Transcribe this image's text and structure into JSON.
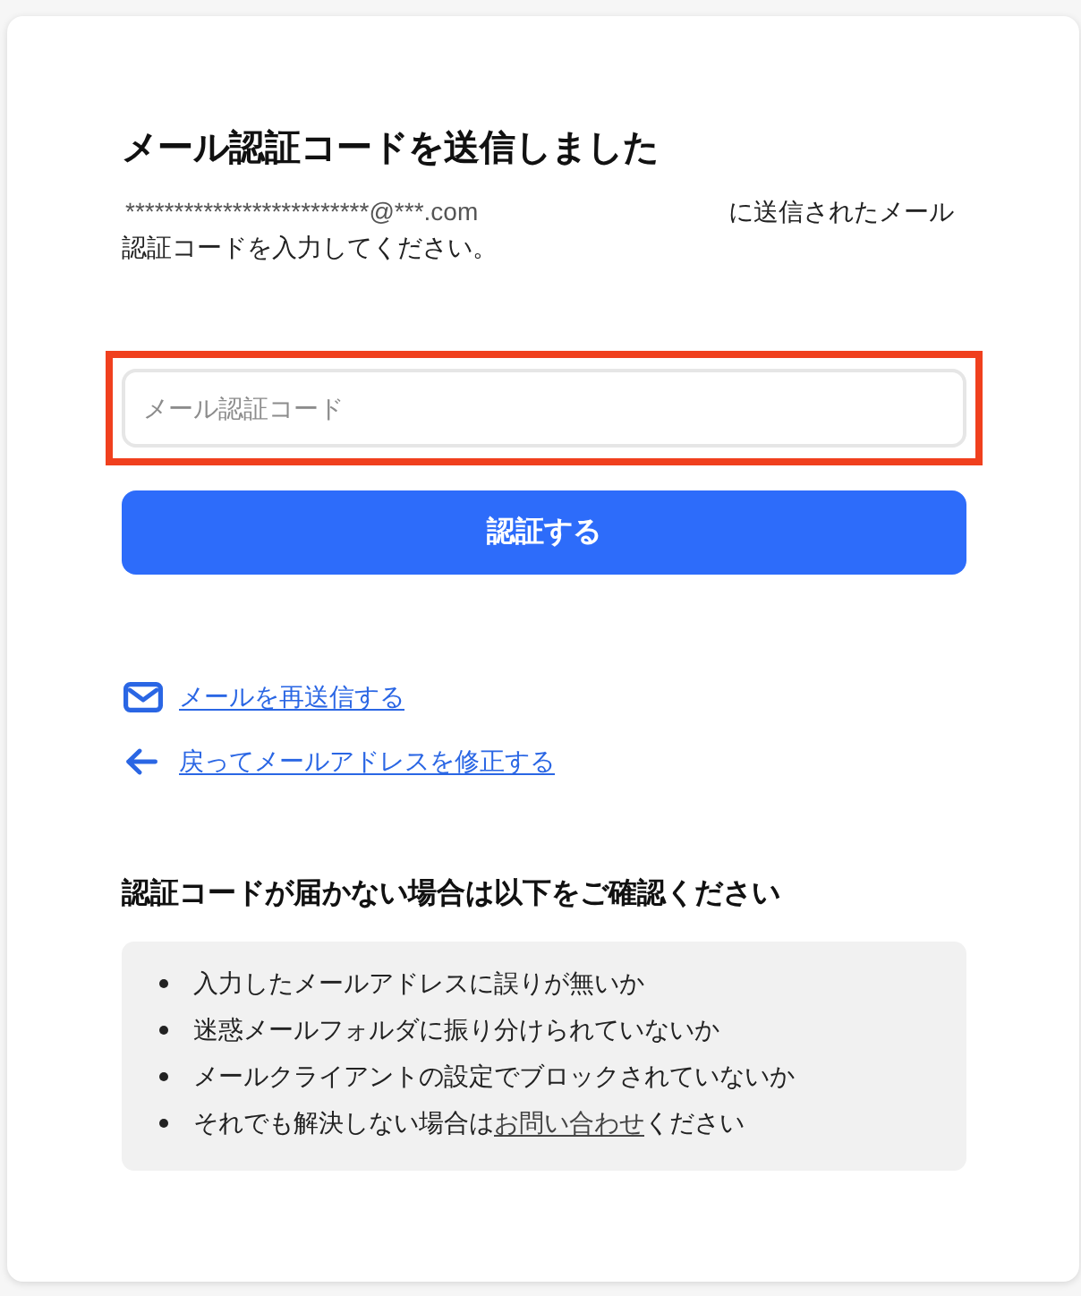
{
  "title": "メール認証コードを送信しました",
  "description": {
    "email": "*************************@***.com",
    "text": "に送信されたメール認証コードを入力してください。"
  },
  "code_field": {
    "placeholder": "メール認証コード",
    "highlighted": true
  },
  "submit_button": {
    "label": "認証する"
  },
  "links": [
    {
      "kind": "resend",
      "label": "メールを再送信する"
    },
    {
      "kind": "back",
      "label": "戻ってメールアドレスを修正する"
    }
  ],
  "help": {
    "heading": "認証コードが届かない場合は以下をご確認ください",
    "items": [
      {
        "text": "入力したメールアドレスに誤りが無いか"
      },
      {
        "text": "迷惑メールフォルダに振り分けられていないか"
      },
      {
        "text": "メールクライアントの設定でブロックされていないか"
      },
      {
        "text": "それでも解決しない場合は",
        "link": "お問い合わせ",
        "text_after": "ください"
      }
    ]
  }
}
